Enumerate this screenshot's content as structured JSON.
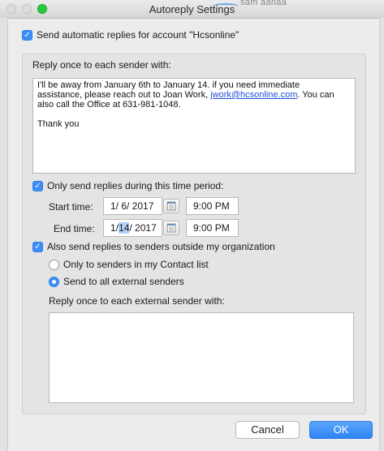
{
  "window": {
    "title": "Autoreply Settings",
    "background_text": "sam aanaa"
  },
  "account": {
    "send_auto_replies_label": "Send automatic replies for account \"Hcsonline\"",
    "checked": true
  },
  "reply_internal": {
    "label": "Reply once to each sender with:",
    "message_line1": "I'll be away from January 6th to January 14. if you need immediate",
    "message_line2_prefix": "assistance, please reach out to Joan Work, ",
    "message_email": "jwork@hcsonline.com",
    "message_line2_suffix": ". You can",
    "message_line3": "also call the Office at 631-981-1048.",
    "message_closing": "Thank you"
  },
  "time_period": {
    "label": "Only send replies during this time period:",
    "checked": true,
    "start_label": "Start time:",
    "start_date": "1/ 6/ 2017",
    "start_time": "9:00 PM",
    "end_label": "End time:",
    "end_date_month": "1/",
    "end_date_day": "14",
    "end_date_year": "/ 2017",
    "end_time": "9:00 PM"
  },
  "external": {
    "label": "Also send replies to senders outside my organization",
    "checked": true,
    "option_contacts": "Only to senders in my Contact list",
    "option_all": "Send to all external senders",
    "selected": "all",
    "reply_label": "Reply once to each external sender with:",
    "message": ""
  },
  "buttons": {
    "cancel": "Cancel",
    "ok": "OK"
  },
  "colors": {
    "accent": "#3a8ef6",
    "link": "#1a4fd6"
  },
  "icons": {
    "calendar": "calendar-icon",
    "checkmark": "checkmark-icon"
  }
}
